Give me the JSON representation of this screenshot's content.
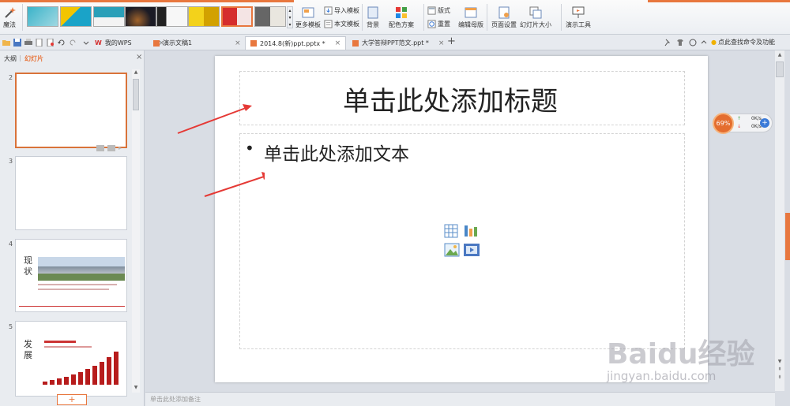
{
  "ribbon": {
    "magic_label": "魔法",
    "more_templates": "更多模板",
    "import_template": "导入模板",
    "this_doc_template": "本文模板",
    "background": "背景",
    "color_scheme": "配色方案",
    "layout": "版式",
    "reset": "重置",
    "edit_master": "编辑母版",
    "page_setup": "页面设置",
    "slide_size": "幻灯片大小",
    "presentation_tools": "演示工具"
  },
  "tabs": [
    {
      "label": "我的WPS"
    },
    {
      "label": "演示文稿1"
    },
    {
      "label": "2014.8(新)ppt.pptx *"
    },
    {
      "label": "大学答辩PPT范文.ppt *"
    }
  ],
  "search_hint": "点此查找命令及功能",
  "leftpanel": {
    "tab_outline": "大纲",
    "tab_slides": "幻灯片",
    "add_label": "+",
    "slides": [
      {
        "num": "2"
      },
      {
        "num": "3"
      },
      {
        "num": "4",
        "side_text": "现状"
      },
      {
        "num": "5",
        "side_text": "发展"
      }
    ]
  },
  "slide": {
    "title_placeholder": "单击此处添加标题",
    "bullet": "•",
    "text_placeholder": "单击此处添加文本"
  },
  "notes_placeholder": "单击此处添加备注",
  "network": {
    "percent": "69%",
    "up": "0K/s",
    "down": "0K/s",
    "plus": "+"
  },
  "watermark": {
    "brand": "Baidu经验",
    "url": "jingyan.baidu.com"
  },
  "colors": {
    "accent": "#e8773e",
    "arrow": "#e53935"
  }
}
